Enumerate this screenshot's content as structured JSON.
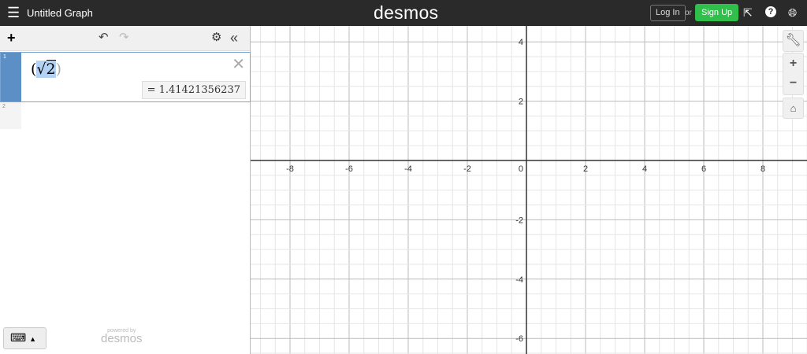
{
  "header": {
    "title": "Untitled Graph",
    "logo": "desmos",
    "login": "Log In",
    "or": "or",
    "signup": "Sign Up",
    "icons": [
      "menu-icon",
      "share-icon",
      "help-icon",
      "globe-icon"
    ]
  },
  "panel": {
    "expressions": [
      {
        "index": "1",
        "latex_open": "(",
        "sqrt": "√",
        "radicand": "2",
        "latex_close": ")",
        "result": "= 1.41421356237"
      },
      {
        "index": "2"
      }
    ],
    "powered_by": "powered by",
    "powered_logo": "desmos"
  },
  "graph": {
    "x_ticks": [
      -8,
      -6,
      -4,
      -2,
      2,
      4,
      6,
      8
    ],
    "y_ticks": [
      -6,
      -4,
      -2,
      2,
      4
    ],
    "origin_label": "0",
    "x_range": [
      -9.3,
      9.5
    ],
    "y_range": [
      -6.6,
      4.4
    ],
    "major_step": 2,
    "minor_step": 0.5
  }
}
